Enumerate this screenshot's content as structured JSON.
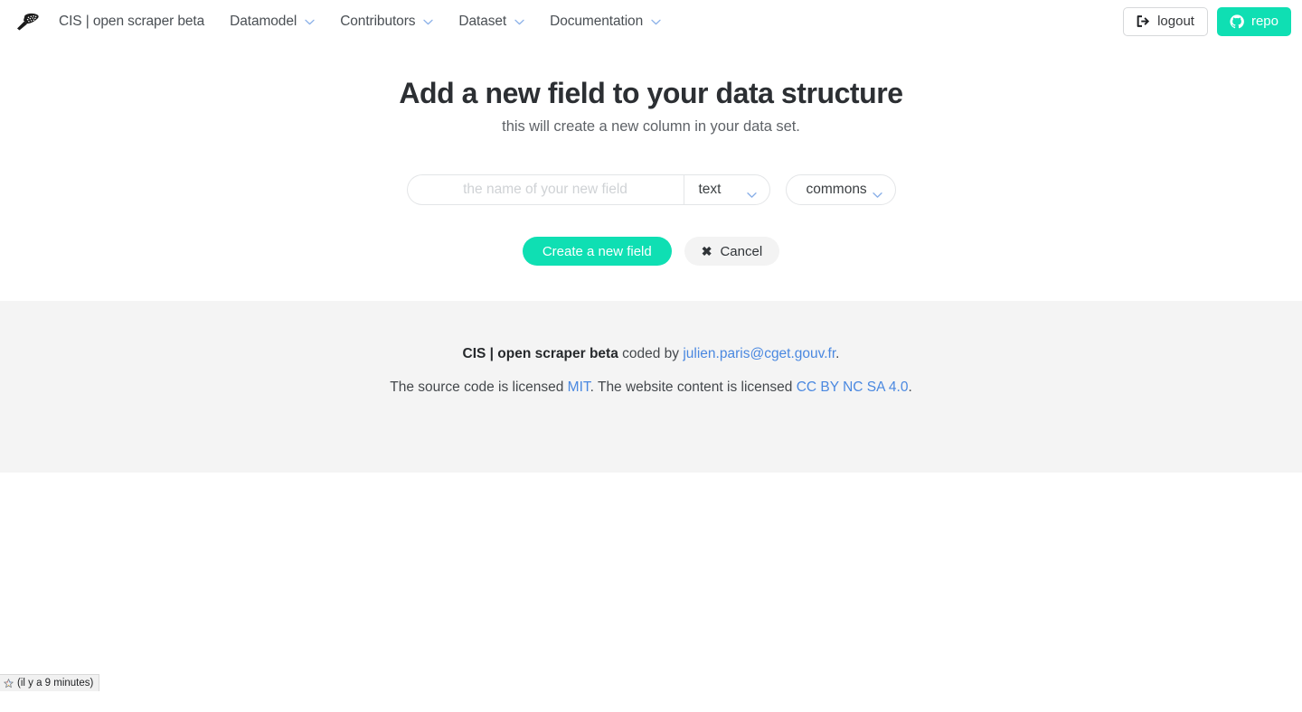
{
  "navbar": {
    "logo_icon": "scraper-logo-icon",
    "brand_label": "CIS | open scraper beta",
    "items": [
      {
        "label": "Datamodel",
        "caret": "chevron-down-icon"
      },
      {
        "label": "Contributors",
        "caret": "chevron-down-icon"
      },
      {
        "label": "Dataset",
        "caret": "chevron-down-icon"
      },
      {
        "label": "Documentation",
        "caret": "chevron-down-icon"
      }
    ],
    "logout_label": "logout",
    "logout_icon": "sign-out-icon",
    "repo_label": "repo",
    "repo_icon": "github-icon"
  },
  "main": {
    "title": "Add a new field to your data structure",
    "subtitle": "this will create a new column in your data set.",
    "field_name_value": "",
    "field_name_placeholder": "the name of your new field",
    "type_select_value": "text",
    "scope_select_value": "commons",
    "create_button_label": "Create a new field",
    "cancel_button_label": "Cancel",
    "cancel_icon": "close-x-icon"
  },
  "footer": {
    "line1_strong": "CIS | open scraper beta",
    "line1_mid": " coded by ",
    "line1_link": "julien.paris@cget.gouv.fr",
    "line1_end": ".",
    "line2_start": "The source code is licensed ",
    "line2_link1": "MIT",
    "line2_mid": ". The website content is licensed ",
    "line2_link2": "CC BY NC SA 4.0",
    "line2_end": "."
  },
  "status_bar": {
    "icon": "star-icon",
    "text": "(il y a 9 minutes)"
  },
  "colors": {
    "accent_teal": "#0fdfb3",
    "link_blue": "#4a88e0",
    "caret_blue": "#8ab0e8",
    "footer_bg": "#f4f4f4"
  }
}
